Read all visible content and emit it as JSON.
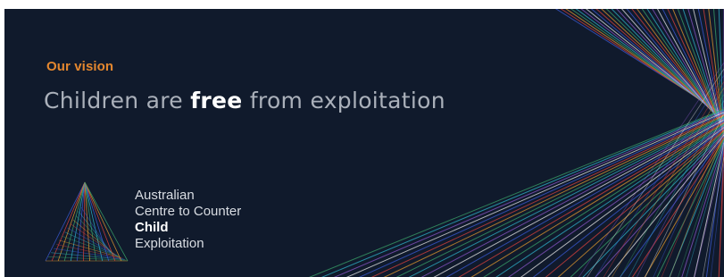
{
  "banner": {
    "eyebrow": "Our vision",
    "headline": {
      "before": "Children are ",
      "emphasis": "free",
      "after": " from exploitation"
    },
    "organisation": {
      "line1": "Australian",
      "line2": "Centre to Counter",
      "line3_bold": "Child",
      "line3_rest": " Exploitation"
    },
    "colors": {
      "background": "#101a2c",
      "eyebrow": "#e4872f",
      "headline": "#aab0ba",
      "emphasis": "#ffffff",
      "line_palette": [
        "#3b5bd6",
        "#d9413c",
        "#e39a2e",
        "#3aa36a",
        "#2fb3c9",
        "#8a55c7",
        "#e8e8e8"
      ]
    }
  }
}
